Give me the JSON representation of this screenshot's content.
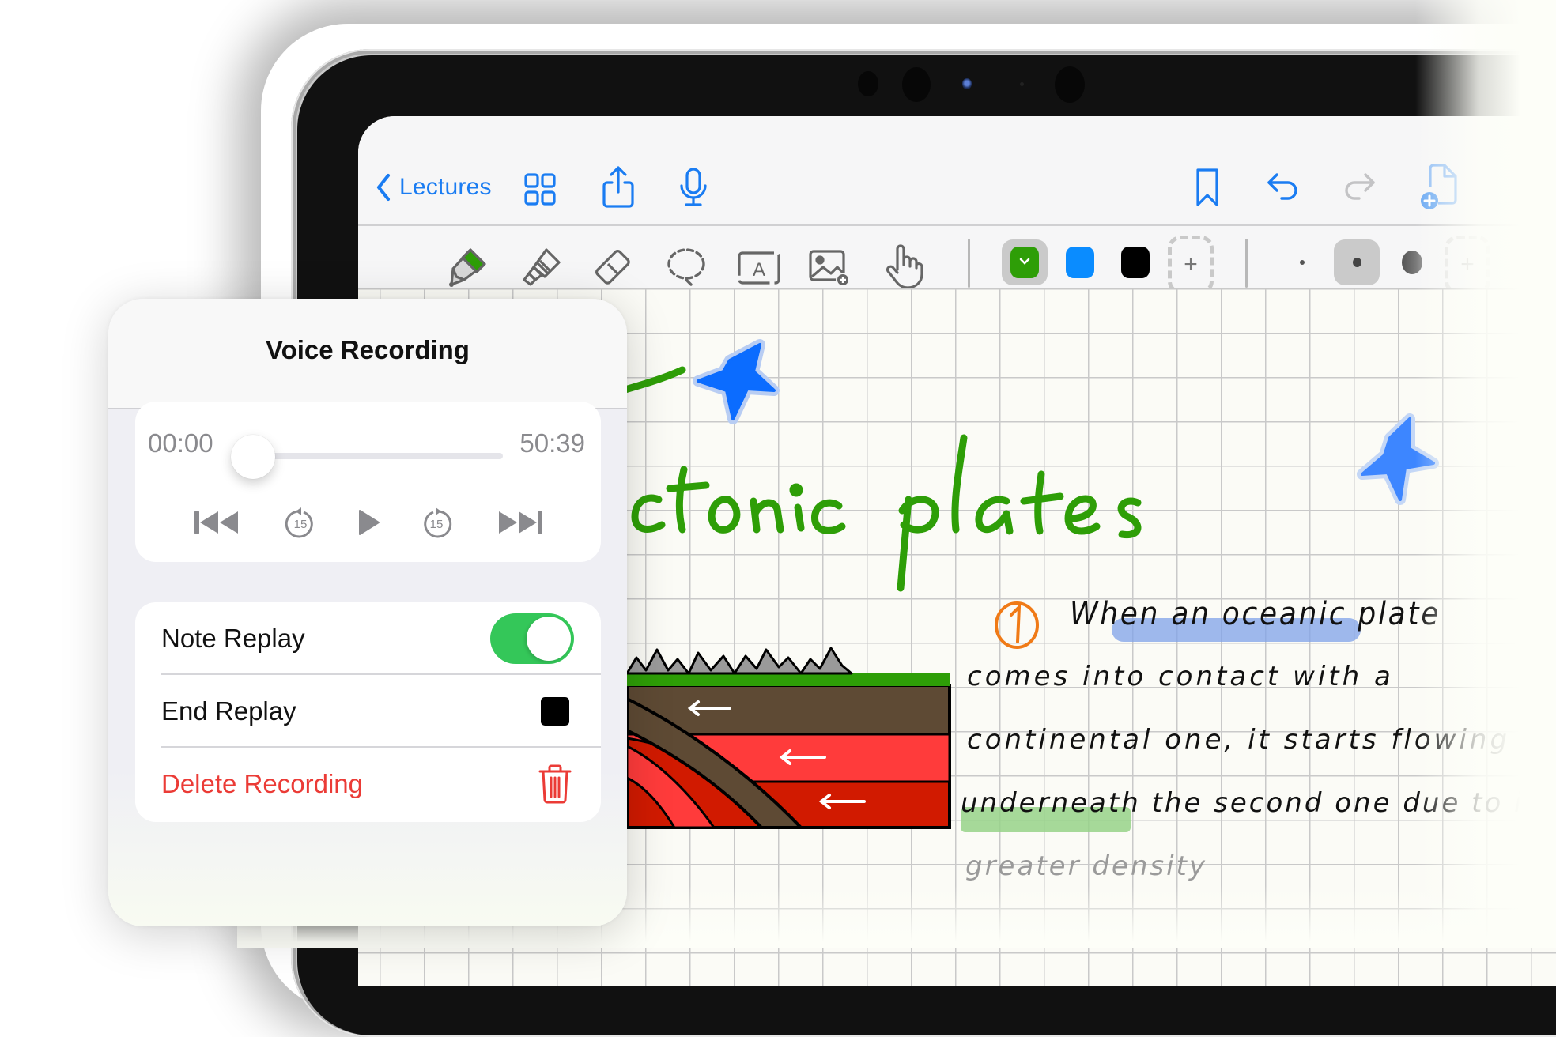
{
  "app": {
    "nav": {
      "back_label": "Lectures",
      "back_icon": "chevron-left-icon",
      "left_icons": [
        "grid-icon",
        "share-icon",
        "microphone-icon"
      ],
      "right_icons": [
        "bookmark-icon",
        "undo-icon",
        "redo-icon",
        "add-page-icon"
      ],
      "redo_enabled": false
    },
    "toolbar": {
      "tools": [
        {
          "name": "pen",
          "icon": "pen-icon",
          "selected": true,
          "accent": "#2e9e07"
        },
        {
          "name": "highlighter",
          "icon": "highlighter-icon"
        },
        {
          "name": "eraser",
          "icon": "eraser-icon"
        },
        {
          "name": "lasso",
          "icon": "lasso-icon"
        },
        {
          "name": "text",
          "icon": "text-box-icon",
          "glyph": "A"
        },
        {
          "name": "image",
          "icon": "add-image-icon"
        },
        {
          "name": "hand",
          "icon": "hand-pointer-icon"
        }
      ],
      "colors": [
        {
          "name": "green",
          "hex": "#2e9e07",
          "selected": true
        },
        {
          "name": "blue",
          "hex": "#0a8cff",
          "selected": false
        },
        {
          "name": "black",
          "hex": "#000000",
          "selected": false
        }
      ],
      "add_color_glyph": "+",
      "sizes": [
        {
          "name": "small",
          "selected": false
        },
        {
          "name": "medium",
          "selected": true
        },
        {
          "name": "large",
          "selected": false
        }
      ],
      "add_size_glyph": "+"
    },
    "canvas": {
      "title_text": "Tectonic plates",
      "title_color": "#2e9e07",
      "star_color": "#0b6cff",
      "note": {
        "number": "1",
        "number_color": "#f07a16",
        "lines": [
          "When an oceanic plate",
          "comes into contact with a",
          "continental one, it starts flowing",
          "underneath the second one due to its",
          "greater density"
        ],
        "highlight_blue": "an oceanic plate",
        "highlight_green": "continental"
      },
      "diagram": "plate-subduction-illustration"
    }
  },
  "voice_recording": {
    "title": "Voice Recording",
    "player": {
      "current_time": "00:00",
      "total_time": "50:39",
      "progress": 0.0,
      "controls": [
        {
          "name": "skip-back",
          "icon": "skip-back-icon"
        },
        {
          "name": "rewind-15",
          "icon": "rewind-15-icon",
          "label": "15"
        },
        {
          "name": "play",
          "icon": "play-icon"
        },
        {
          "name": "forward-15",
          "icon": "forward-15-icon",
          "label": "15"
        },
        {
          "name": "skip-forward",
          "icon": "skip-forward-icon"
        }
      ]
    },
    "options": [
      {
        "label": "Note Replay",
        "type": "toggle",
        "value": true
      },
      {
        "label": "End Replay",
        "type": "stop",
        "icon": "stop-icon"
      },
      {
        "label": "Delete Recording",
        "type": "destructive",
        "icon": "trash-icon",
        "color": "#eb3b36"
      }
    ],
    "toggle_color": "#34c759"
  }
}
